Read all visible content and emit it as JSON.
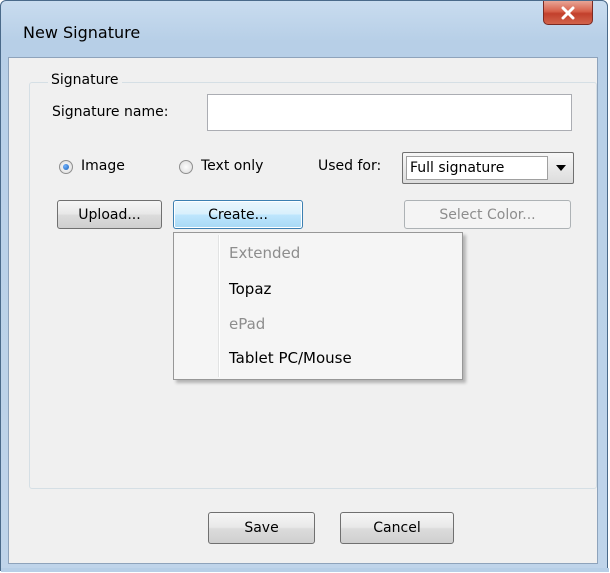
{
  "window": {
    "title": "New Signature",
    "close_glyph": "X"
  },
  "signature_group": {
    "title": "Signature",
    "name_label": "Signature name:",
    "name_value": "",
    "name_placeholder": ""
  },
  "mode": {
    "image_label": "Image",
    "image_checked": true,
    "text_only_label": "Text only",
    "text_only_checked": false
  },
  "used_for": {
    "label": "Used for:",
    "selected": "Full signature"
  },
  "buttons": {
    "upload": "Upload...",
    "create": "Create...",
    "select_color": "Select Color...",
    "save": "Save",
    "cancel": "Cancel"
  },
  "create_menu": {
    "items": [
      {
        "label": "Extended",
        "enabled": false
      },
      {
        "label": "Topaz",
        "enabled": true
      },
      {
        "label": "ePad",
        "enabled": false
      },
      {
        "label": "Tablet PC/Mouse",
        "enabled": true
      }
    ]
  },
  "colors": {
    "titlebar": "#b7cfe7",
    "close_button": "#c94a36",
    "dialog_face": "#f0f0f0",
    "focus_button": "#bee6fd",
    "disabled_text": "#8d8d8d"
  },
  "icons": {
    "close": "close-icon",
    "dropdown": "chevron-down-icon"
  }
}
